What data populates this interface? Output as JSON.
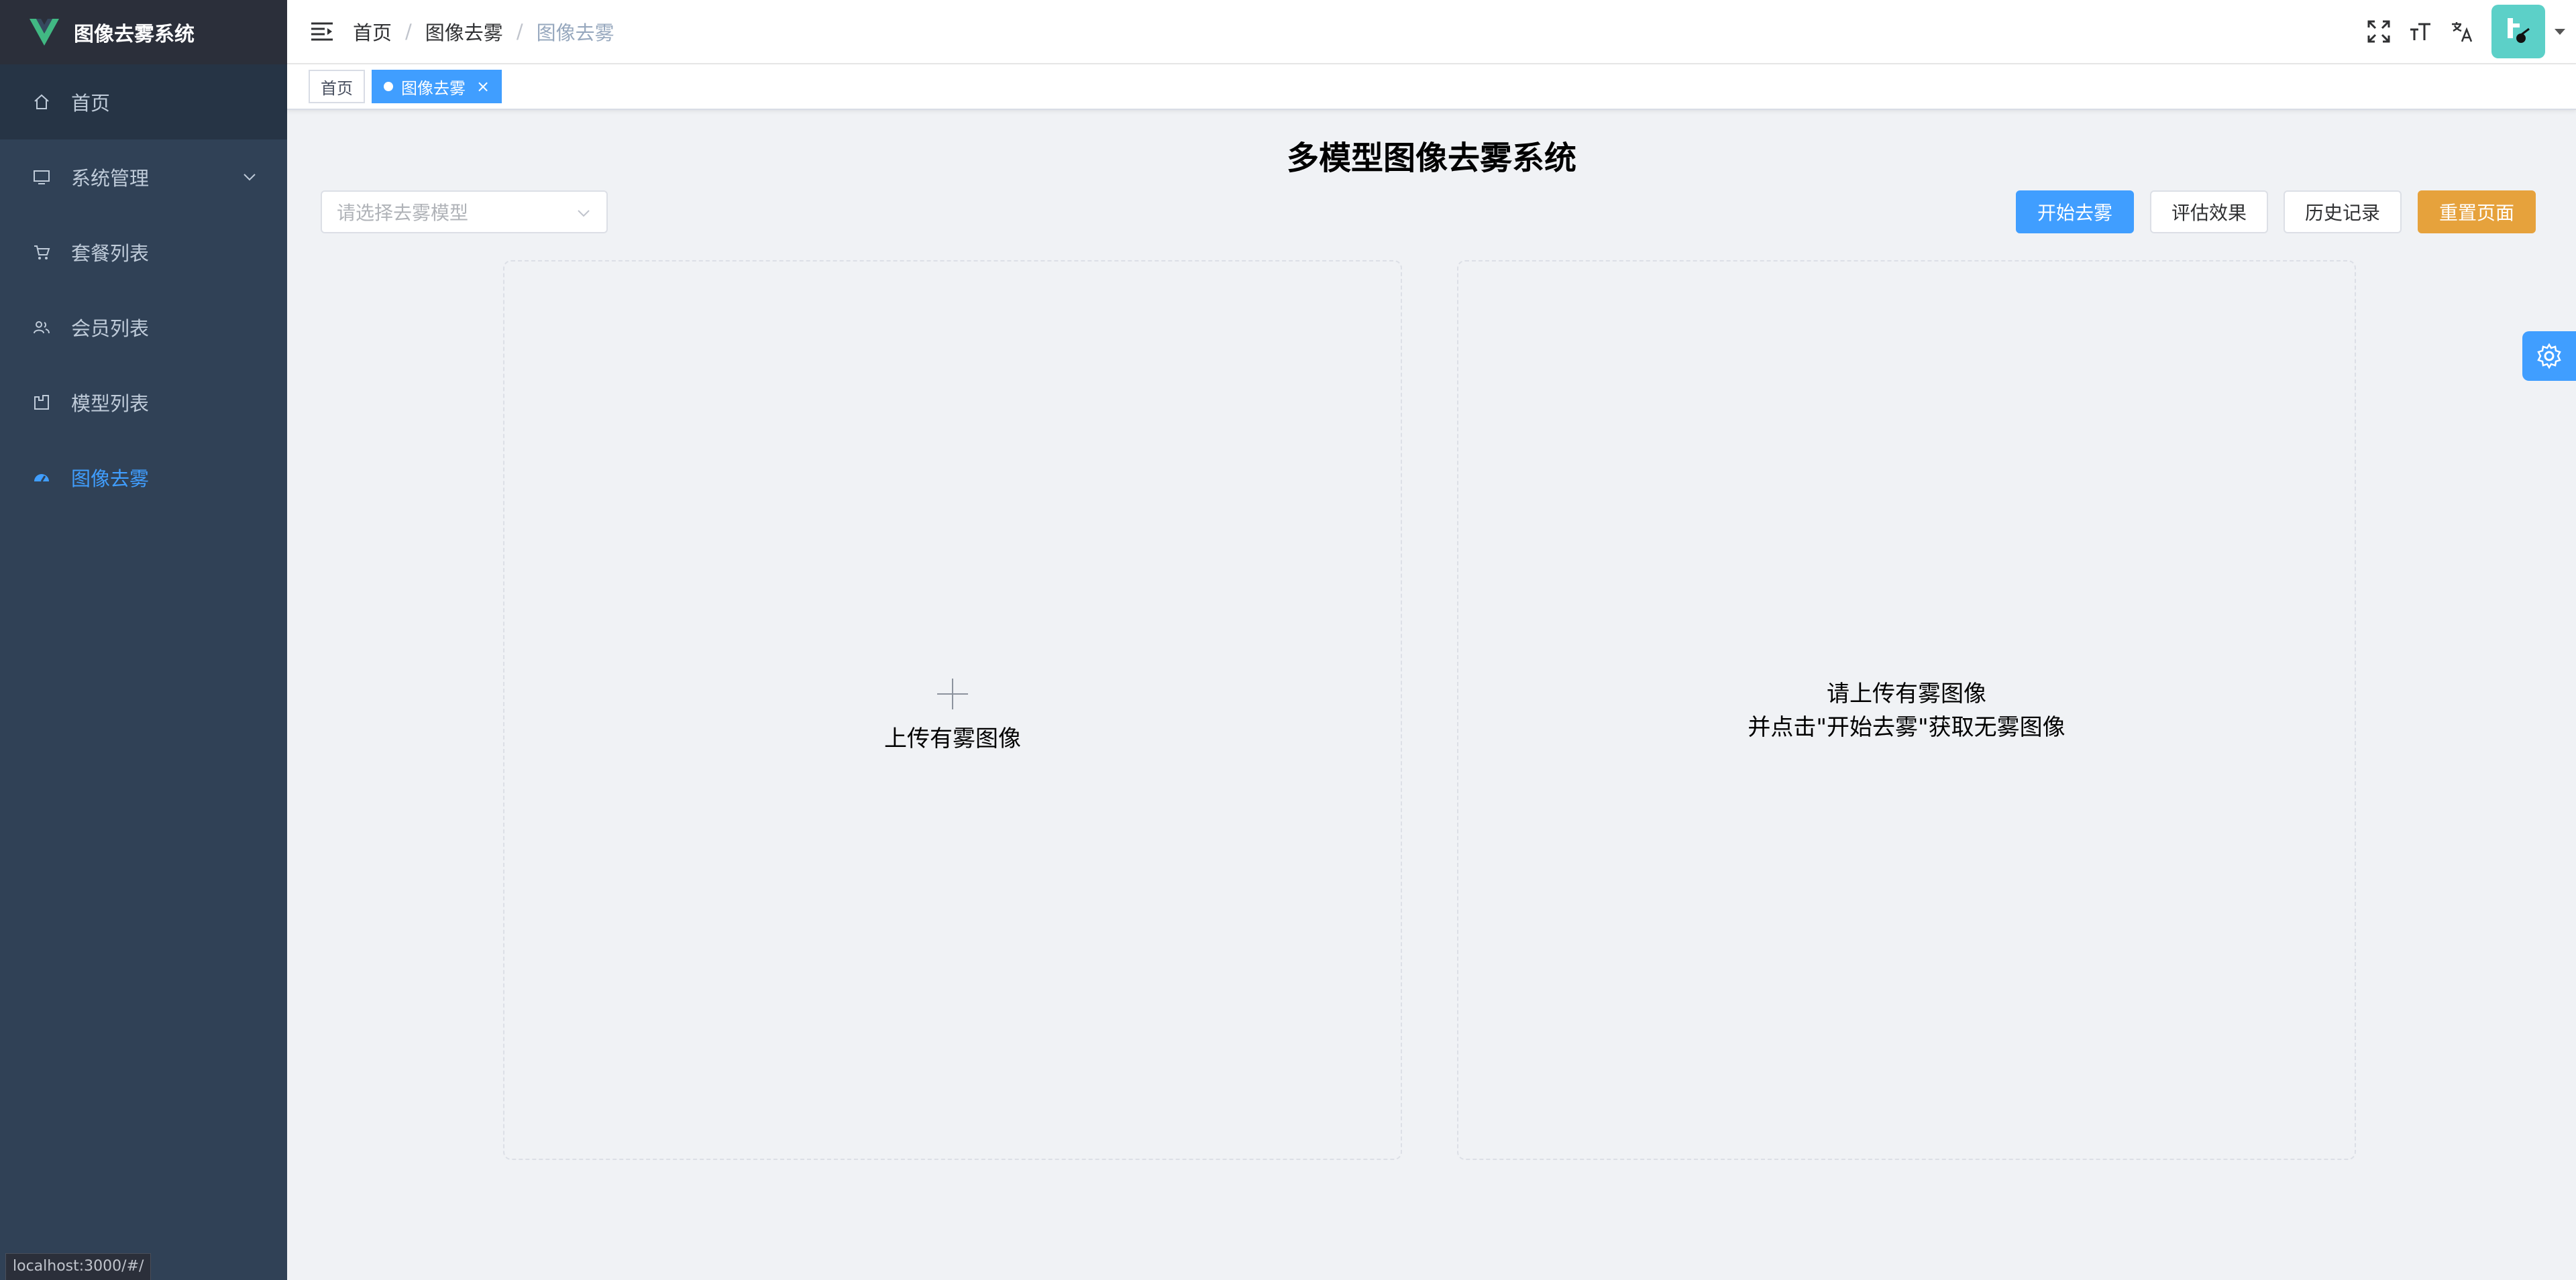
{
  "app": {
    "title": "图像去雾系统",
    "status_url": "localhost:3000/#/"
  },
  "sidebar": {
    "items": [
      {
        "label": "首页",
        "icon": "home-icon"
      },
      {
        "label": "系统管理",
        "icon": "monitor-icon",
        "expandable": true
      },
      {
        "label": "套餐列表",
        "icon": "cart-icon"
      },
      {
        "label": "会员列表",
        "icon": "users-icon"
      },
      {
        "label": "模型列表",
        "icon": "model-icon"
      },
      {
        "label": "图像去雾",
        "icon": "dashboard-icon",
        "active": true
      }
    ]
  },
  "breadcrumb": [
    "首页",
    "图像去雾",
    "图像去雾"
  ],
  "tags": [
    {
      "label": "首页"
    },
    {
      "label": "图像去雾",
      "active": true
    }
  ],
  "main": {
    "title": "多模型图像去雾系统",
    "select_placeholder": "请选择去雾模型",
    "buttons": {
      "start": "开始去雾",
      "evaluate": "评估效果",
      "history": "历史记录",
      "reset": "重置页面"
    },
    "upload_text": "上传有雾图像",
    "result_hint_line1": "请上传有雾图像",
    "result_hint_line2": "并点击\"开始去雾\"获取无雾图像"
  },
  "colors": {
    "primary": "#409eff",
    "warning": "#e6a23c",
    "sidebar_bg": "#304156",
    "sidebar_text": "#bfcbd9"
  }
}
